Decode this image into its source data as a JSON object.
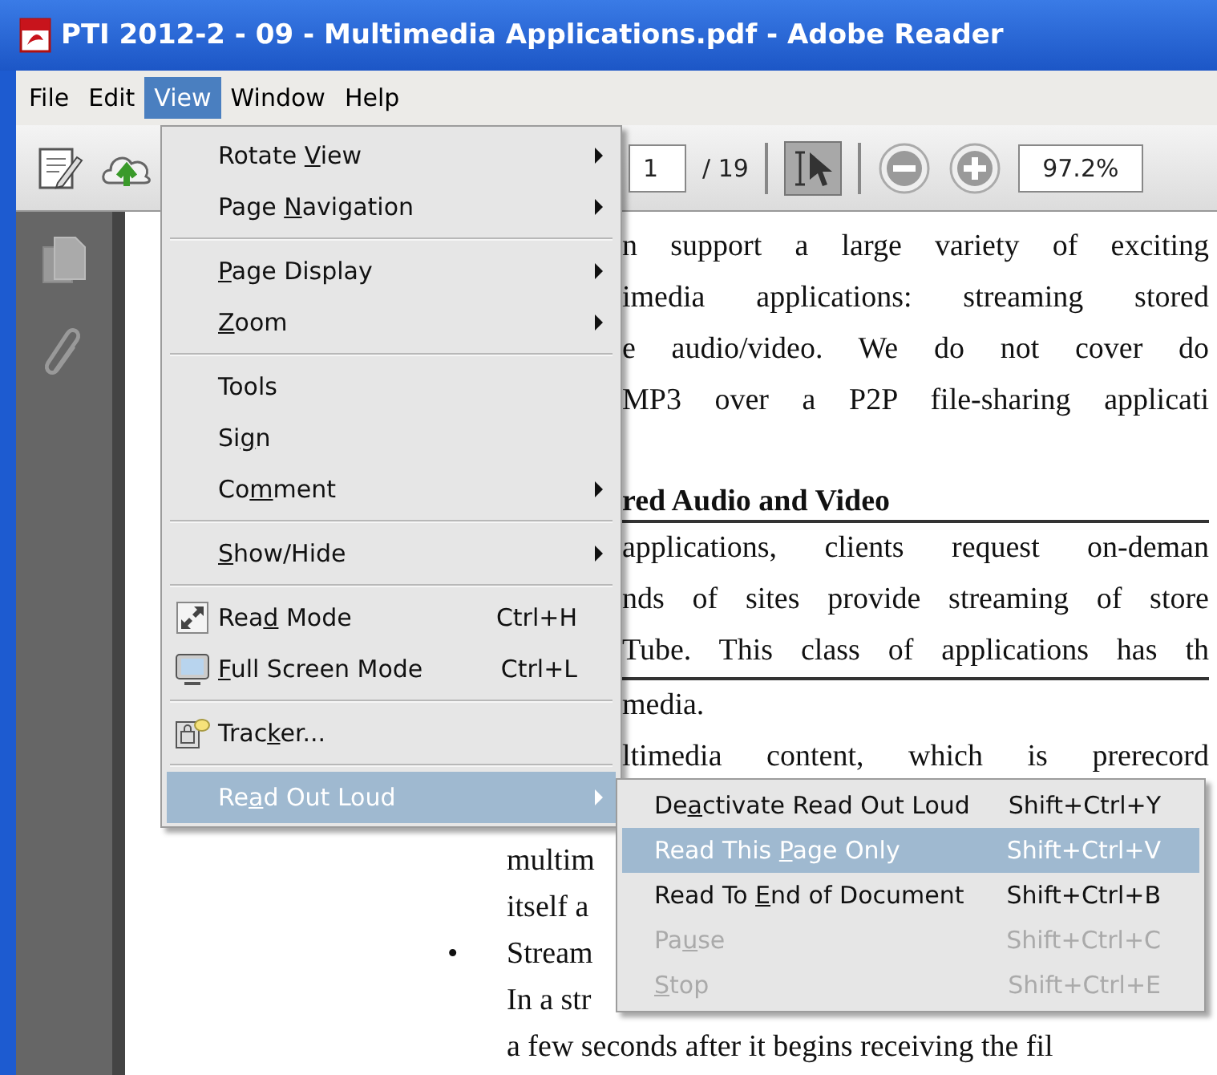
{
  "window": {
    "title": "PTI 2012-2 - 09 - Multimedia Applications.pdf - Adobe Reader"
  },
  "menubar": [
    {
      "label": "File",
      "selected": false
    },
    {
      "label": "Edit",
      "selected": false
    },
    {
      "label": "View",
      "selected": true
    },
    {
      "label": "Window",
      "selected": false
    },
    {
      "label": "Help",
      "selected": false
    }
  ],
  "toolbar": {
    "page_field": {
      "value": "1"
    },
    "page_count": "/ 19",
    "select_tool": {
      "selected": true
    },
    "zoom_field": {
      "value": "97.2%"
    }
  },
  "view_menu": [
    {
      "kind": "item",
      "label": [
        {
          "text": "Rotate "
        },
        {
          "text": "V",
          "underline": true
        },
        {
          "text": "iew"
        }
      ],
      "submenu": true,
      "selected": false,
      "disabled": false
    },
    {
      "kind": "item",
      "label": [
        {
          "text": "Page "
        },
        {
          "text": "N",
          "underline": true
        },
        {
          "text": "avigation"
        }
      ],
      "submenu": true,
      "selected": false,
      "disabled": false
    },
    {
      "kind": "separator"
    },
    {
      "kind": "item",
      "label": [
        {
          "text": "P",
          "underline": true
        },
        {
          "text": "age Display"
        }
      ],
      "submenu": true,
      "selected": false,
      "disabled": false
    },
    {
      "kind": "item",
      "label": [
        {
          "text": "Z",
          "underline": true
        },
        {
          "text": "oom"
        }
      ],
      "submenu": true,
      "selected": false,
      "disabled": false
    },
    {
      "kind": "separator"
    },
    {
      "kind": "item",
      "label": [
        {
          "text": "Tools"
        }
      ],
      "submenu": false,
      "selected": false,
      "disabled": false
    },
    {
      "kind": "item",
      "label": [
        {
          "text": "Si"
        },
        {
          "text": "g",
          "underline": true
        },
        {
          "text": "n"
        }
      ],
      "submenu": false,
      "selected": false,
      "disabled": false
    },
    {
      "kind": "item",
      "label": [
        {
          "text": "Co"
        },
        {
          "text": "m",
          "underline": true
        },
        {
          "text": "ment"
        }
      ],
      "submenu": true,
      "selected": false,
      "disabled": false
    },
    {
      "kind": "separator"
    },
    {
      "kind": "item",
      "label": [
        {
          "text": "S",
          "underline": true
        },
        {
          "text": "how/Hide"
        }
      ],
      "submenu": true,
      "selected": false,
      "disabled": false
    },
    {
      "kind": "separator"
    },
    {
      "kind": "item",
      "label": [
        {
          "text": "Rea"
        },
        {
          "text": "d",
          "underline": true
        },
        {
          "text": " Mode"
        }
      ],
      "shortcut": "Ctrl+H",
      "submenu": false,
      "selected": false,
      "disabled": false
    },
    {
      "kind": "item",
      "label": [
        {
          "text": "F",
          "underline": true
        },
        {
          "text": "ull Screen Mode"
        }
      ],
      "shortcut": "Ctrl+L",
      "submenu": false,
      "selected": false,
      "disabled": false
    },
    {
      "kind": "separator"
    },
    {
      "kind": "item",
      "label": [
        {
          "text": "Trac"
        },
        {
          "text": "k",
          "underline": true
        },
        {
          "text": "er..."
        }
      ],
      "submenu": false,
      "selected": false,
      "disabled": false
    },
    {
      "kind": "separator"
    },
    {
      "kind": "item",
      "label": [
        {
          "text": "Re"
        },
        {
          "text": "a",
          "underline": true
        },
        {
          "text": "d Out Loud"
        }
      ],
      "submenu": true,
      "selected": true,
      "disabled": false
    }
  ],
  "read_out_loud_menu": [
    {
      "kind": "item",
      "label": [
        {
          "text": "De"
        },
        {
          "text": "a",
          "underline": true
        },
        {
          "text": "ctivate Read Out Loud"
        }
      ],
      "shortcut": "Shift+Ctrl+Y",
      "selected": false,
      "disabled": false
    },
    {
      "kind": "item",
      "label": [
        {
          "text": "Read This "
        },
        {
          "text": "P",
          "underline": true
        },
        {
          "text": "age Only"
        }
      ],
      "shortcut": "Shift+Ctrl+V",
      "selected": true,
      "disabled": false
    },
    {
      "kind": "item",
      "label": [
        {
          "text": "Read To "
        },
        {
          "text": "E",
          "underline": true
        },
        {
          "text": "nd of Document"
        }
      ],
      "shortcut": "Shift+Ctrl+B",
      "selected": false,
      "disabled": false
    },
    {
      "kind": "item",
      "label": [
        {
          "text": "Pa"
        },
        {
          "text": "u",
          "underline": true
        },
        {
          "text": "se"
        }
      ],
      "shortcut": "Shift+Ctrl+C",
      "selected": false,
      "disabled": true
    },
    {
      "kind": "item",
      "label": [
        {
          "text": "S",
          "underline": true
        },
        {
          "text": "top"
        }
      ],
      "shortcut": "Shift+Ctrl+E",
      "selected": false,
      "disabled": true
    }
  ],
  "document": {
    "top_lines": [
      "n support a large variety of exciting",
      "imedia applications: streaming stored",
      "e audio/video. We do not cover do",
      "MP3 over a P2P file-sharing applicati"
    ],
    "heading": "red Audio and Video",
    "middle_lines": [
      "applications, clients request on-deman",
      "nds of sites provide streaming of store",
      "Tube. This class of applications has th",
      "media.",
      "ltimedia content, which is prerecord"
    ],
    "lower_lines": [
      {
        "text": "multim"
      },
      {
        "text": "itself a"
      },
      {
        "text": "Stream",
        "marker": "•"
      },
      {
        "text": "In a str"
      },
      {
        "text": "a few seconds after it begins receiving the fil"
      }
    ]
  }
}
